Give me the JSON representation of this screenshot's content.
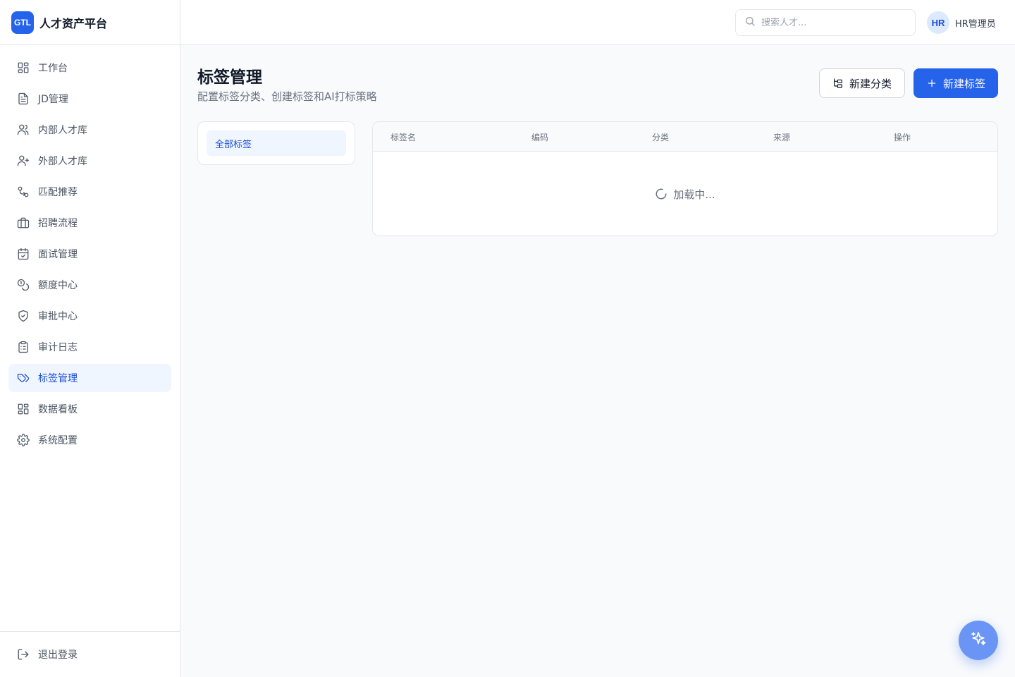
{
  "brand": {
    "logo": "GTL",
    "name": "人才资产平台"
  },
  "sidebar": {
    "items": [
      {
        "label": "工作台",
        "icon": "dashboard-icon"
      },
      {
        "label": "JD管理",
        "icon": "document-icon"
      },
      {
        "label": "内部人才库",
        "icon": "users-icon"
      },
      {
        "label": "外部人才库",
        "icon": "user-plus-icon"
      },
      {
        "label": "匹配推荐",
        "icon": "git-compare-icon"
      },
      {
        "label": "招聘流程",
        "icon": "briefcase-icon"
      },
      {
        "label": "面试管理",
        "icon": "calendar-check-icon"
      },
      {
        "label": "额度中心",
        "icon": "coins-icon"
      },
      {
        "label": "审批中心",
        "icon": "shield-check-icon"
      },
      {
        "label": "审计日志",
        "icon": "clipboard-icon"
      },
      {
        "label": "标签管理",
        "icon": "tags-icon",
        "active": true
      },
      {
        "label": "数据看板",
        "icon": "dashboard-icon"
      },
      {
        "label": "系统配置",
        "icon": "gear-icon"
      }
    ],
    "logout": "退出登录"
  },
  "header": {
    "search_placeholder": "搜索人才...",
    "avatar": "HR",
    "user_name": "HR管理员"
  },
  "main": {
    "title": "标签管理",
    "subtitle": "配置标签分类、创建标签和AI打标策略",
    "new_category_label": "新建分类",
    "new_tag_label": "新建标签",
    "categories": [
      "全部标签"
    ],
    "table": {
      "columns": [
        "标签名",
        "编码",
        "分类",
        "来源",
        "操作"
      ],
      "loading_text": "加载中..."
    }
  },
  "colors": {
    "accent": "#2563eb",
    "active_bg": "#eff6ff",
    "active_text": "#1d4ed8"
  }
}
